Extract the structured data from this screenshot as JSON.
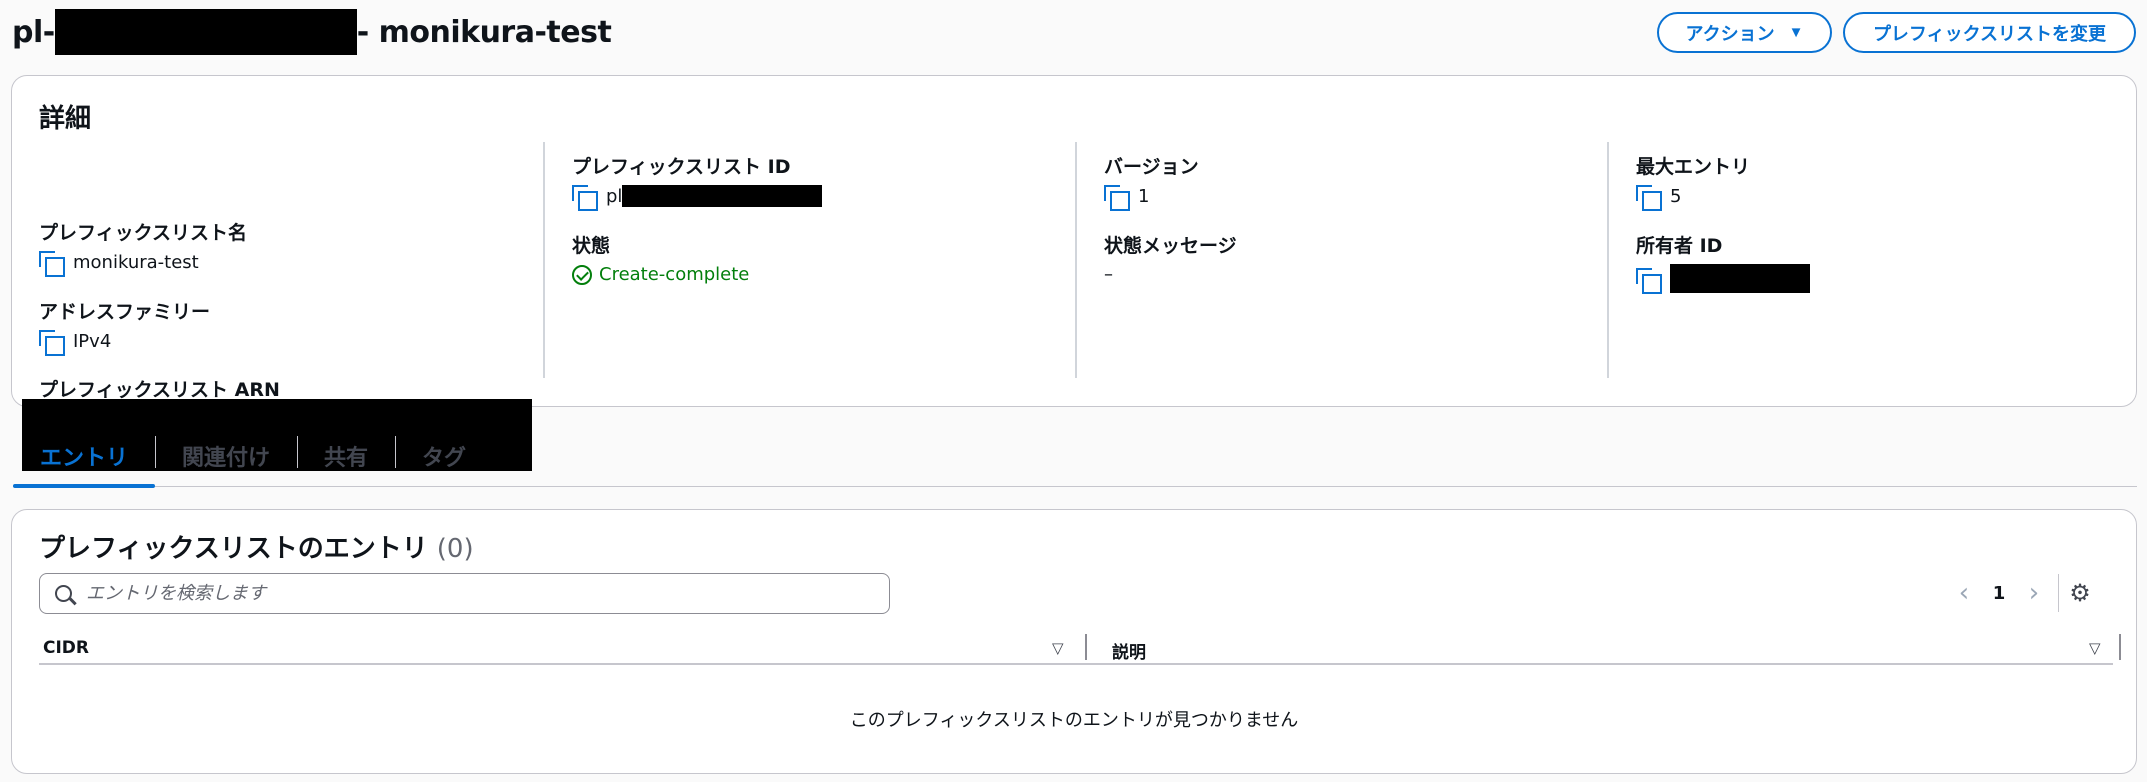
{
  "header": {
    "title_prefix": "pl-",
    "title_suffix": "- monikura-test",
    "actions_label": "アクション",
    "modify_label": "プレフィックスリストを変更"
  },
  "details": {
    "heading": "詳細",
    "name_label": "プレフィックスリスト名",
    "name_value": "monikura-test",
    "family_label": "アドレスファミリー",
    "family_value": "IPv4",
    "arn_label": "プレフィックスリスト ARN",
    "id_label": "プレフィックスリスト ID",
    "id_value_prefix": "pl",
    "state_label": "状態",
    "state_value": "Create-complete",
    "version_label": "バージョン",
    "version_value": "1",
    "state_msg_label": "状態メッセージ",
    "state_msg_value": "–",
    "max_label": "最大エントリ",
    "max_value": "5",
    "owner_label": "所有者 ID"
  },
  "tabs": [
    {
      "label": "エントリ",
      "active": true
    },
    {
      "label": "関連付け",
      "active": false
    },
    {
      "label": "共有",
      "active": false
    },
    {
      "label": "タグ",
      "active": false
    }
  ],
  "entries": {
    "heading": "プレフィックスリストのエントリ",
    "count": "(0)",
    "search_placeholder": "エントリを検索します",
    "page": "1",
    "columns": [
      "CIDR",
      "説明"
    ],
    "empty_message": "このプレフィックスリストのエントリが見つかりません"
  },
  "icons": {
    "copy": "copy-icon",
    "status": "check-circle-icon",
    "search": "search-icon",
    "settings": "gear-icon"
  },
  "colors": {
    "accent": "#0972d3",
    "success": "#037f0c"
  }
}
